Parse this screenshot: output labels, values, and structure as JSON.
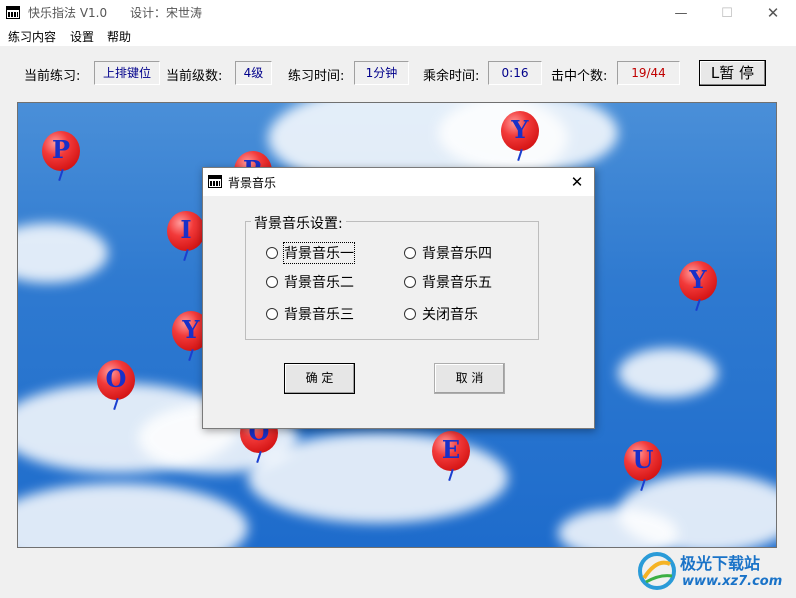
{
  "window": {
    "title": "快乐指法 V1.0      设计：宋世涛",
    "minimize": "—",
    "maximize": "☐",
    "close": "✕"
  },
  "menu": [
    {
      "label": "练习内容"
    },
    {
      "label": "设置"
    },
    {
      "label": "帮助"
    }
  ],
  "status": {
    "current_practice_label": "当前练习:",
    "current_practice_value": "上排键位",
    "current_level_label": "当前级数:",
    "current_level_value": "4级",
    "practice_time_label": "练习时间:",
    "practice_time_value": "1分钟",
    "remaining_time_label": "乘余时间:",
    "remaining_time_value": "0:16",
    "hits_label": "击中个数:",
    "hits_value": "19/44",
    "pause_button": "L暂  停"
  },
  "balloons": [
    {
      "letter": "P"
    },
    {
      "letter": "R"
    },
    {
      "letter": "Y"
    },
    {
      "letter": "I"
    },
    {
      "letter": "Y"
    },
    {
      "letter": "Y"
    },
    {
      "letter": "O"
    },
    {
      "letter": "O"
    },
    {
      "letter": "E"
    },
    {
      "letter": "U"
    }
  ],
  "dialog": {
    "title": "背景音乐",
    "close": "✕",
    "group_label": "背景音乐设置:",
    "options": [
      {
        "label": "背景音乐一"
      },
      {
        "label": "背景音乐二"
      },
      {
        "label": "背景音乐三"
      },
      {
        "label": "背景音乐四"
      },
      {
        "label": "背景音乐五"
      },
      {
        "label": "关闭音乐"
      }
    ],
    "ok_button": "确  定",
    "cancel_button": "取  消"
  },
  "watermark": {
    "brand": "极光下载站",
    "url": "www.xz7.com"
  },
  "colors": {
    "value_text": "#00008b",
    "hits_text": "#c00000",
    "balloon": "#e81c1c",
    "balloon_letter": "#1830c8",
    "sky": "#2f7ad0",
    "watermark": "#1a73c8"
  }
}
